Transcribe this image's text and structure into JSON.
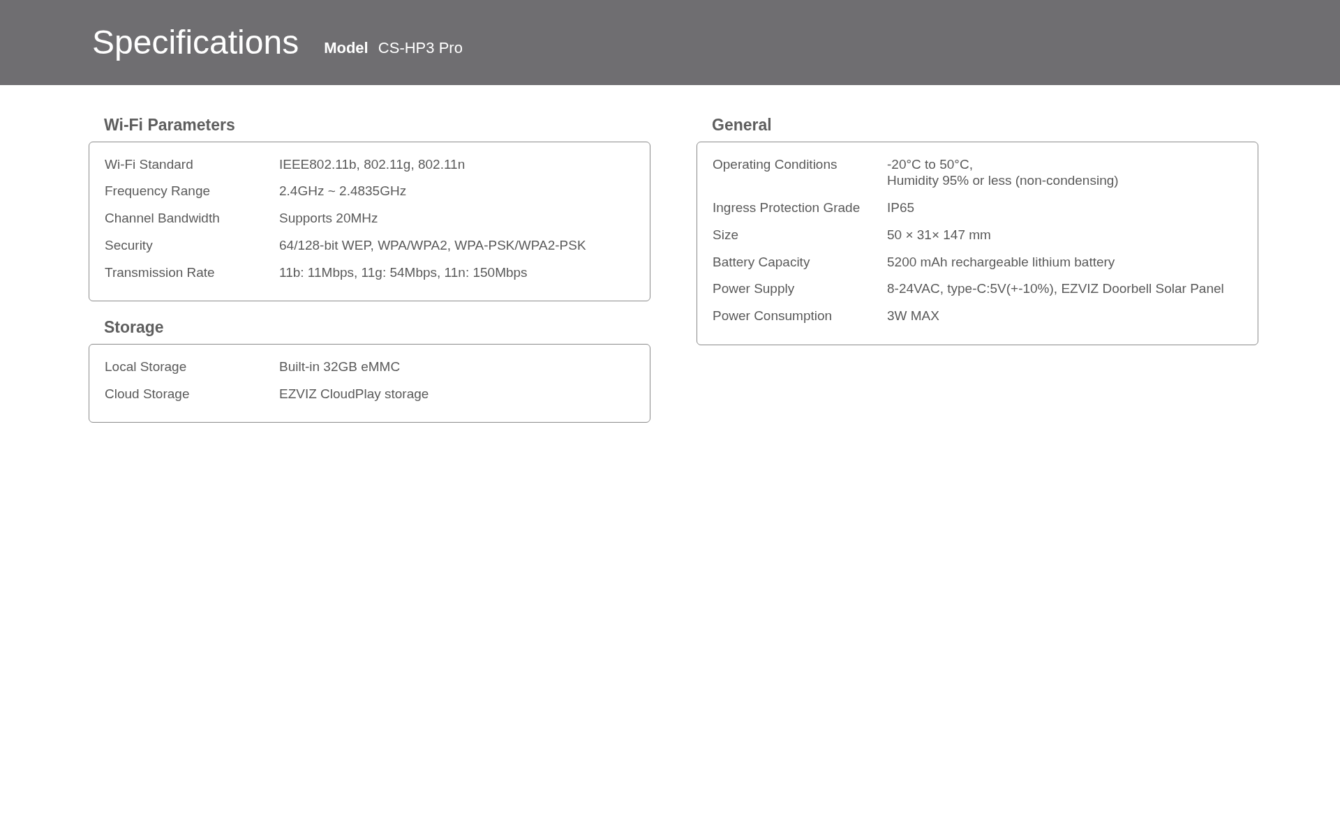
{
  "header": {
    "title": "Specifications",
    "model_label": "Model",
    "model_value": "CS-HP3 Pro"
  },
  "columns": [
    [
      {
        "title": "Wi-Fi Parameters",
        "rows": [
          {
            "label": "Wi-Fi Standard",
            "value": "IEEE802.11b, 802.11g, 802.11n"
          },
          {
            "label": "Frequency Range",
            "value": "2.4GHz ~ 2.4835GHz"
          },
          {
            "label": "Channel Bandwidth",
            "value": "Supports 20MHz"
          },
          {
            "label": "Security",
            "value": "64/128-bit WEP, WPA/WPA2, WPA-PSK/WPA2-PSK"
          },
          {
            "label": "Transmission Rate",
            "value": "11b: 11Mbps, 11g: 54Mbps, 11n: 150Mbps"
          }
        ]
      },
      {
        "title": "Storage",
        "rows": [
          {
            "label": "Local Storage",
            "value": "Built-in 32GB eMMC"
          },
          {
            "label": "Cloud Storage",
            "value": "EZVIZ CloudPlay storage"
          }
        ]
      }
    ],
    [
      {
        "title": "General",
        "rows": [
          {
            "label": "Operating Conditions",
            "value": "-20°C to 50°C,\nHumidity 95% or less (non-condensing)"
          },
          {
            "label": "Ingress Protection Grade",
            "value": "IP65"
          },
          {
            "label": "Size",
            "value": "50 × 31× 147 mm"
          },
          {
            "label": "Battery Capacity",
            "value": "5200 mAh rechargeable lithium battery"
          },
          {
            "label": "Power Supply",
            "value": "8-24VAC, type-C:5V(+-10%), EZVIZ Doorbell Solar Panel"
          },
          {
            "label": "Power Consumption",
            "value": "3W MAX"
          }
        ]
      }
    ]
  ]
}
